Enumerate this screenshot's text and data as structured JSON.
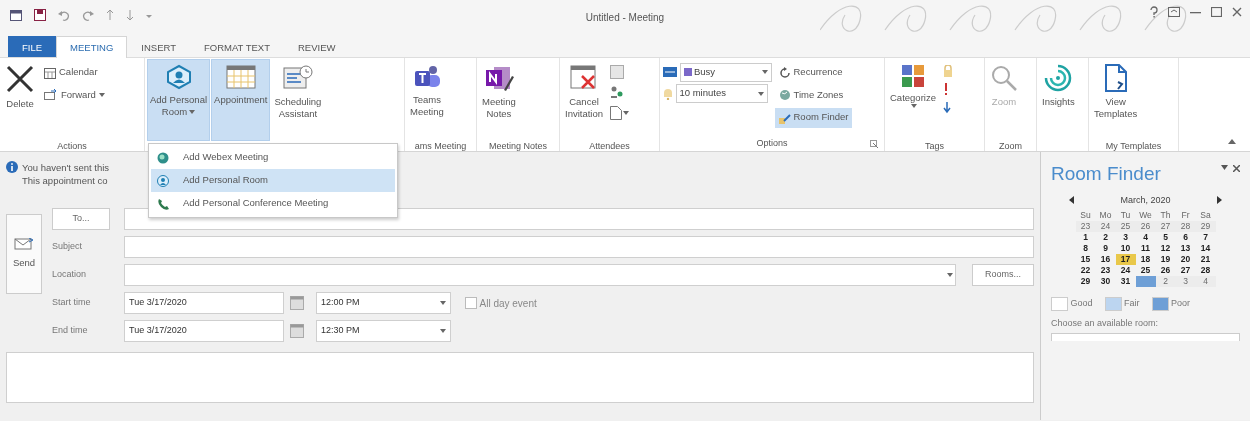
{
  "window": {
    "title": "Untitled - Meeting"
  },
  "tabs": [
    {
      "label": "FILE",
      "kind": "file",
      "selected": false
    },
    {
      "label": "MEETING",
      "kind": "tab",
      "selected": true
    },
    {
      "label": "INSERT",
      "kind": "tab",
      "selected": false
    },
    {
      "label": "FORMAT TEXT",
      "kind": "tab",
      "selected": false
    },
    {
      "label": "REVIEW",
      "kind": "tab",
      "selected": false
    }
  ],
  "ribbon": {
    "groups": [
      {
        "label": "Actions",
        "items": [
          {
            "kind": "large",
            "lines": [
              "Delete"
            ],
            "selected": false,
            "caret": false
          },
          {
            "kind": "small",
            "lines": [
              "Calendar"
            ],
            "selected": false,
            "caret": false
          },
          {
            "kind": "small",
            "lines": [
              "Forward"
            ],
            "selected": false,
            "caret": true
          }
        ]
      },
      {
        "items": [
          {
            "kind": "large",
            "lines": [
              "Add Personal",
              "Room"
            ],
            "selected": true,
            "caret": true
          },
          {
            "kind": "large",
            "lines": [
              "Appointment"
            ],
            "selected": true,
            "caret": false
          },
          {
            "kind": "large",
            "lines": [
              "Scheduling",
              "Assistant"
            ],
            "selected": false,
            "caret": false
          }
        ]
      },
      {
        "label": "ams Meeting",
        "items": [
          {
            "kind": "large",
            "lines": [
              "Teams",
              "Meeting"
            ],
            "selected": false,
            "caret": false
          }
        ]
      },
      {
        "label": "Meeting Notes",
        "items": [
          {
            "kind": "large",
            "lines": [
              "Meeting",
              "Notes"
            ],
            "selected": false,
            "caret": false
          }
        ]
      },
      {
        "label": "Attendees",
        "items": [
          {
            "kind": "large",
            "lines": [
              "Cancel",
              "Invitation"
            ],
            "selected": false,
            "caret": false
          },
          {
            "kind": "icon",
            "selected": false,
            "caret": false
          },
          {
            "kind": "icon",
            "selected": false,
            "caret": false
          },
          {
            "kind": "icon",
            "selected": false,
            "caret": true
          }
        ]
      },
      {
        "label": "Options",
        "items": [
          {
            "kind": "combo",
            "lines": [
              "Busy"
            ],
            "selected": false,
            "caret": true
          },
          {
            "kind": "combo",
            "lines": [
              "10 minutes"
            ],
            "selected": false,
            "caret": true
          },
          {
            "kind": "small",
            "lines": [
              "Recurrence"
            ],
            "selected": false,
            "caret": false
          },
          {
            "kind": "small",
            "lines": [
              "Time Zones"
            ],
            "selected": false,
            "caret": false
          },
          {
            "kind": "small",
            "lines": [
              "Room Finder"
            ],
            "selected": true,
            "caret": false
          }
        ]
      },
      {
        "label": "Tags",
        "items": [
          {
            "kind": "large",
            "lines": [
              "Categorize"
            ],
            "selected": false,
            "caret": true
          },
          {
            "kind": "icon",
            "selected": false,
            "caret": false
          },
          {
            "kind": "icon",
            "selected": false,
            "caret": false
          },
          {
            "kind": "icon",
            "selected": false,
            "caret": false
          }
        ]
      },
      {
        "label": "Zoom",
        "items": [
          {
            "kind": "large",
            "lines": [
              "Zoom"
            ],
            "selected": false,
            "caret": false,
            "disabled": true
          }
        ]
      },
      {
        "items": [
          {
            "kind": "large",
            "lines": [
              "Insights"
            ],
            "selected": false,
            "caret": false
          }
        ]
      },
      {
        "label": "My Templates",
        "items": [
          {
            "kind": "large",
            "lines": [
              "View",
              "Templates"
            ],
            "selected": false,
            "caret": false
          }
        ]
      }
    ]
  },
  "menu": {
    "items": [
      {
        "label": "Add Webex Meeting",
        "selected": false
      },
      {
        "label": "Add Personal Room",
        "selected": true
      },
      {
        "label": "Add Personal Conference Meeting",
        "selected": false
      }
    ]
  },
  "info_bar": {
    "lines": [
      "You haven't sent this",
      "This appointment co"
    ]
  },
  "form": {
    "send": "Send",
    "to_button": "To...",
    "subject_label": "Subject",
    "location_label": "Location",
    "rooms_button": "Rooms...",
    "start": {
      "label": "Start time",
      "date": "Tue 3/17/2020",
      "time": "12:00 PM"
    },
    "end": {
      "label": "End time",
      "date": "Tue 3/17/2020",
      "time": "12:30 PM"
    },
    "all_day": {
      "label": "All day event",
      "checked": false
    }
  },
  "room_finder": {
    "title": "Room Finder",
    "month": "March, 2020",
    "weekdays": [
      "Su",
      "Mo",
      "Tu",
      "We",
      "Th",
      "Fr",
      "Sa"
    ],
    "weeks": [
      [
        {
          "text": "23",
          "kind": "other"
        },
        {
          "text": "24",
          "kind": "other"
        },
        {
          "text": "25",
          "kind": "other"
        },
        {
          "text": "26",
          "kind": "other"
        },
        {
          "text": "27",
          "kind": "other"
        },
        {
          "text": "28",
          "kind": "other"
        },
        {
          "text": "29",
          "kind": "other"
        }
      ],
      [
        {
          "text": "1",
          "kind": "day"
        },
        {
          "text": "2",
          "kind": "day"
        },
        {
          "text": "3",
          "kind": "day"
        },
        {
          "text": "4",
          "kind": "day"
        },
        {
          "text": "5",
          "kind": "day"
        },
        {
          "text": "6",
          "kind": "day"
        },
        {
          "text": "7",
          "kind": "day"
        }
      ],
      [
        {
          "text": "8",
          "kind": "day"
        },
        {
          "text": "9",
          "kind": "day"
        },
        {
          "text": "10",
          "kind": "day"
        },
        {
          "text": "11",
          "kind": "day"
        },
        {
          "text": "12",
          "kind": "day"
        },
        {
          "text": "13",
          "kind": "day"
        },
        {
          "text": "14",
          "kind": "day"
        }
      ],
      [
        {
          "text": "15",
          "kind": "day"
        },
        {
          "text": "16",
          "kind": "day"
        },
        {
          "text": "17",
          "kind": "day",
          "selected": true
        },
        {
          "text": "18",
          "kind": "day"
        },
        {
          "text": "19",
          "kind": "day"
        },
        {
          "text": "20",
          "kind": "day"
        },
        {
          "text": "21",
          "kind": "day"
        }
      ],
      [
        {
          "text": "22",
          "kind": "day"
        },
        {
          "text": "23",
          "kind": "day"
        },
        {
          "text": "24",
          "kind": "day"
        },
        {
          "text": "25",
          "kind": "day"
        },
        {
          "text": "26",
          "kind": "day"
        },
        {
          "text": "27",
          "kind": "day"
        },
        {
          "text": "28",
          "kind": "day"
        }
      ],
      [
        {
          "text": "29",
          "kind": "day"
        },
        {
          "text": "30",
          "kind": "day"
        },
        {
          "text": "31",
          "kind": "day"
        },
        {
          "kind": "poor"
        },
        {
          "text": "2",
          "kind": "other"
        },
        {
          "text": "3",
          "kind": "other"
        },
        {
          "text": "4",
          "kind": "other"
        }
      ]
    ],
    "legend": [
      {
        "label": "Good",
        "color": "#ffffff"
      },
      {
        "label": "Fair",
        "color": "#bcd5f0"
      },
      {
        "label": "Poor",
        "color": "#6e9fd6"
      }
    ],
    "choose_label": "Choose an available room:"
  }
}
